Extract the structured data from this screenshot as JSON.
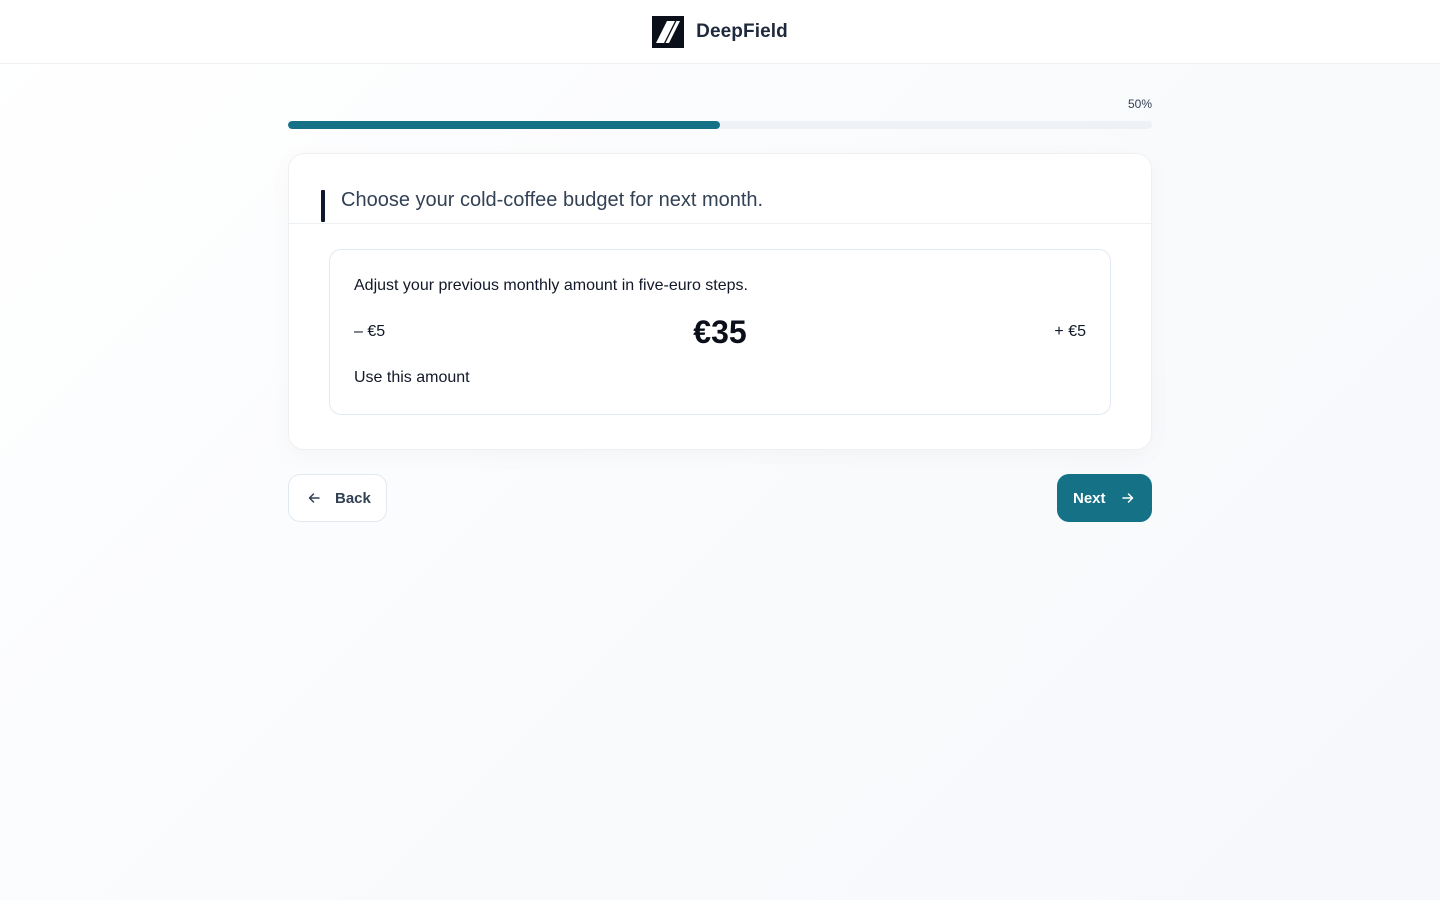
{
  "header": {
    "brand_name": "DeepField",
    "logo_icon": "deepfield-slash-logo-icon"
  },
  "progress": {
    "label": "50%",
    "value_percent": 50,
    "fill_color": "#147186",
    "track_color": "#eef2f6"
  },
  "question": {
    "title": "Choose your cold-coffee budget for next month.",
    "stepper": {
      "hint": "Adjust your previous monthly amount in five-euro steps.",
      "decrement_label": "– €5",
      "increment_label": "+ €5",
      "current_value": "€35",
      "confirm_label": "Use this amount"
    }
  },
  "navigation": {
    "back_label": "Back",
    "back_icon": "arrow-left-icon",
    "next_label": "Next",
    "next_icon": "arrow-right-icon",
    "accent_color": "#147186"
  }
}
